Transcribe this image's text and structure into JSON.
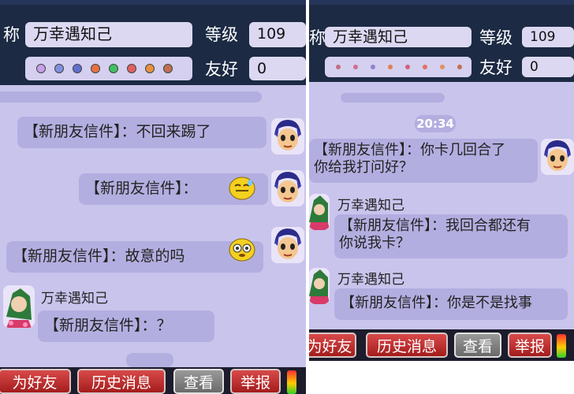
{
  "left": {
    "header": {
      "name_label": "称",
      "name_value": "万幸遇知己",
      "level_label": "等级",
      "level_value": "109",
      "friend_label": "友好",
      "friend_value": "0"
    },
    "messages": [
      {
        "text": "【新朋友信件】：不回来踢了"
      },
      {
        "text": "【新朋友信件】："
      },
      {
        "text": "【新朋友信件】：故意的吗"
      },
      {
        "sender": "万幸遇知己",
        "text": "【新朋友信件】：？"
      }
    ],
    "footer": {
      "add_friend": "为好友",
      "history": "历史消息",
      "view": "查看",
      "report": "举报"
    }
  },
  "right": {
    "header": {
      "name_label": "称",
      "name_value": "万幸遇知己",
      "level_label": "等级",
      "level_value": "109",
      "friend_label": "友好",
      "friend_value": "0"
    },
    "time": "20:34",
    "messages": [
      {
        "text": "【新朋友信件】：你卡几回合了\n你给我打问好？"
      },
      {
        "sender": "万幸遇知己",
        "text": "【新朋友信件】：我回合都还有\n你说我卡？"
      },
      {
        "sender": "万幸遇知己",
        "text": "【新朋友信件】：你是不是找事"
      }
    ],
    "footer": {
      "add_friend": "为好友",
      "history": "历史消息",
      "view": "查看",
      "report": "举报"
    }
  },
  "colors": {
    "header_bg": "#1c2a44",
    "chat_bg": "#c9c4ec",
    "bubble": "#b3aee0",
    "button_red": "#c0302f",
    "button_grey": "#8a8a8a"
  },
  "icons": [
    "hero-avatar-icon",
    "xianxian-avatar-icon",
    "sweat-emoji-icon",
    "dazed-emoji-icon",
    "attribute-badge-icon",
    "volume-meter-icon"
  ]
}
